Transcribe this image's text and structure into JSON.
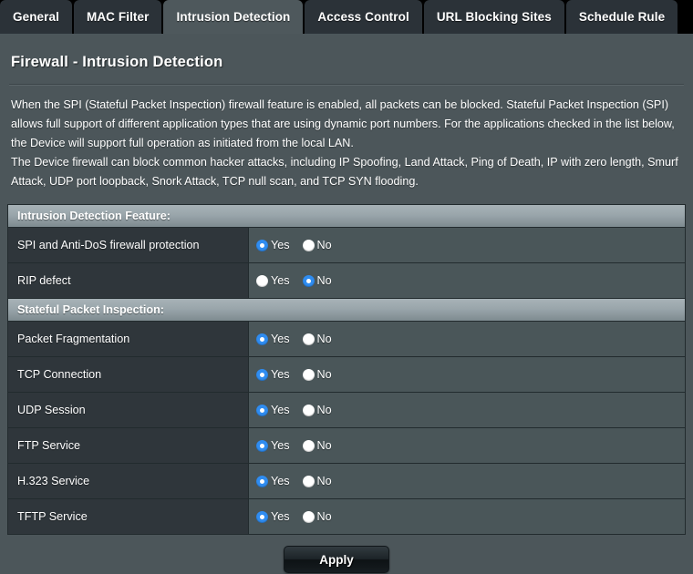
{
  "tabs": [
    {
      "label": "General",
      "active": false
    },
    {
      "label": "MAC Filter",
      "active": false
    },
    {
      "label": "Intrusion Detection",
      "active": true
    },
    {
      "label": "Access Control",
      "active": false
    },
    {
      "label": "URL Blocking Sites",
      "active": false
    },
    {
      "label": "Schedule Rule",
      "active": false
    }
  ],
  "page": {
    "title": "Firewall - Intrusion Detection",
    "description": [
      "When the SPI (Stateful Packet Inspection) firewall feature is enabled, all packets can be blocked. Stateful Packet Inspection (SPI) allows full support of different application types that are using dynamic port numbers.  For the applications checked in the list below, the Device will support full operation as initiated from the local LAN.",
      "The Device firewall can block common hacker attacks, including IP Spoofing, Land Attack, Ping of Death, IP with zero length, Smurf Attack, UDP port loopback, Snork Attack, TCP null scan, and TCP SYN flooding."
    ]
  },
  "radio_labels": {
    "yes": "Yes",
    "no": "No"
  },
  "sections": [
    {
      "heading": "Intrusion Detection Feature:",
      "rows": [
        {
          "label": "SPI and Anti-DoS firewall protection",
          "value": "Yes"
        },
        {
          "label": "RIP defect",
          "value": "No"
        }
      ]
    },
    {
      "heading": "Stateful Packet Inspection:",
      "rows": [
        {
          "label": "Packet Fragmentation",
          "value": "Yes"
        },
        {
          "label": "TCP Connection",
          "value": "Yes"
        },
        {
          "label": "UDP Session",
          "value": "Yes"
        },
        {
          "label": "FTP Service",
          "value": "Yes"
        },
        {
          "label": "H.323 Service",
          "value": "Yes"
        },
        {
          "label": "TFTP Service",
          "value": "Yes"
        }
      ]
    }
  ],
  "footer": {
    "apply_label": "Apply"
  },
  "colors": {
    "page_background": "#4c565a",
    "tabbar_background": "#000000",
    "tab_inactive": "#2b3238",
    "tab_active": "#4e585c",
    "label_cell": "#2f363b",
    "value_cell": "#4a5659",
    "section_header": "#9aa6ab",
    "radio_selected": "#2f8cf0",
    "border": "#222b2e"
  }
}
